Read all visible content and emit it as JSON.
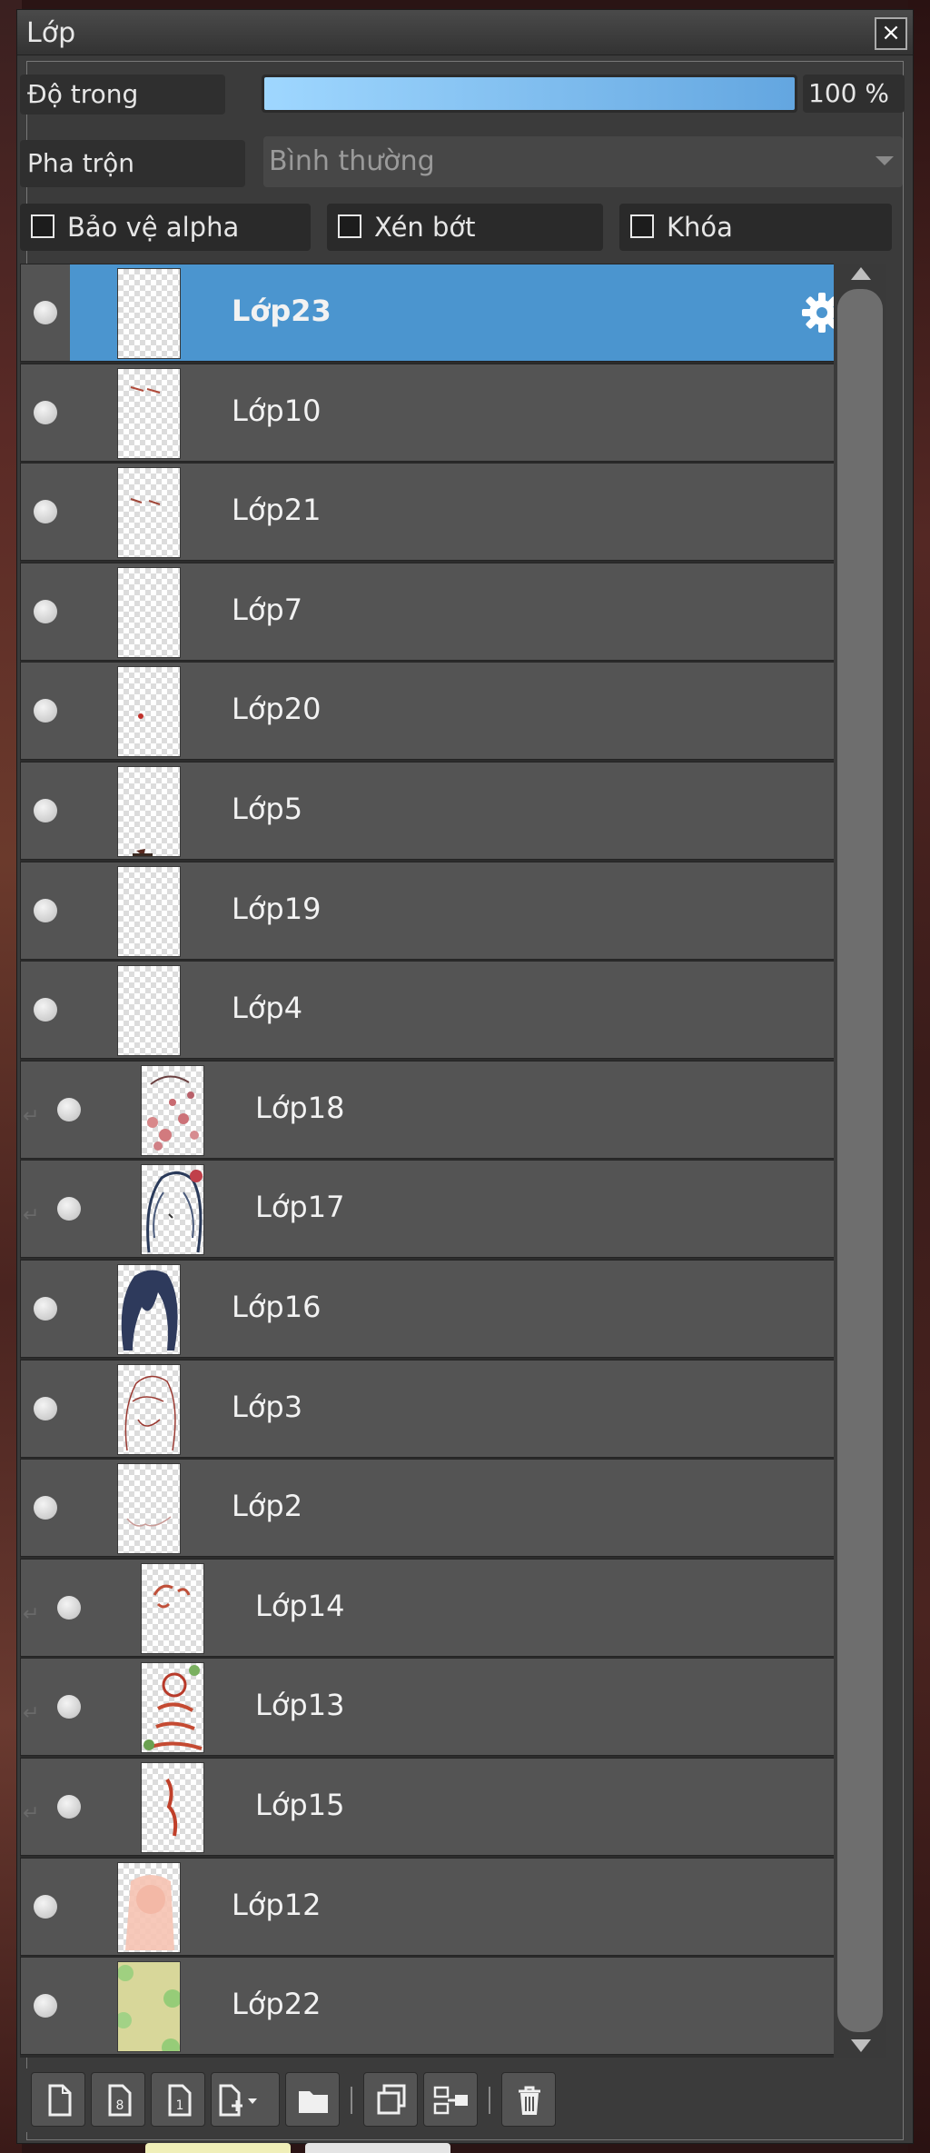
{
  "panel": {
    "title": "Lớp",
    "close_label": "×"
  },
  "opacity": {
    "label": "Độ trong",
    "value_text": "100 %",
    "fraction": 1.0
  },
  "blend": {
    "label": "Pha trộn",
    "selected": "Bình thường"
  },
  "checkboxes": {
    "protect_alpha": "Bảo vệ alpha",
    "clipping": "Xén bớt",
    "lock": "Khóa"
  },
  "layers": [
    {
      "name": "Lớp23",
      "selected": true,
      "clipped": false,
      "thumb": "blank"
    },
    {
      "name": "Lớp10",
      "selected": false,
      "clipped": false,
      "thumb": "strokes-top"
    },
    {
      "name": "Lớp21",
      "selected": false,
      "clipped": false,
      "thumb": "strokes-mid"
    },
    {
      "name": "Lớp7",
      "selected": false,
      "clipped": false,
      "thumb": "blank"
    },
    {
      "name": "Lớp20",
      "selected": false,
      "clipped": false,
      "thumb": "dot-red"
    },
    {
      "name": "Lớp5",
      "selected": false,
      "clipped": false,
      "thumb": "dot-bottom"
    },
    {
      "name": "Lớp19",
      "selected": false,
      "clipped": false,
      "thumb": "blank"
    },
    {
      "name": "Lớp4",
      "selected": false,
      "clipped": false,
      "thumb": "blank"
    },
    {
      "name": "Lớp18",
      "selected": false,
      "clipped": true,
      "thumb": "red-speckle"
    },
    {
      "name": "Lớp17",
      "selected": false,
      "clipped": true,
      "thumb": "hair-outline"
    },
    {
      "name": "Lớp16",
      "selected": false,
      "clipped": false,
      "thumb": "hair-dark"
    },
    {
      "name": "Lớp3",
      "selected": false,
      "clipped": false,
      "thumb": "sketch-red"
    },
    {
      "name": "Lớp2",
      "selected": false,
      "clipped": false,
      "thumb": "sketch-faint"
    },
    {
      "name": "Lớp14",
      "selected": false,
      "clipped": true,
      "thumb": "red-marks"
    },
    {
      "name": "Lớp13",
      "selected": false,
      "clipped": true,
      "thumb": "red-figure"
    },
    {
      "name": "Lớp15",
      "selected": false,
      "clipped": true,
      "thumb": "red-stroke"
    },
    {
      "name": "Lớp12",
      "selected": false,
      "clipped": false,
      "thumb": "skin"
    },
    {
      "name": "Lớp22",
      "selected": false,
      "clipped": false,
      "thumb": "green-bg"
    }
  ],
  "toolbar": [
    {
      "icon": "new-layer-icon"
    },
    {
      "icon": "new-8bit-layer-icon"
    },
    {
      "icon": "new-1bit-layer-icon"
    },
    {
      "icon": "add-layer-dropdown-icon"
    },
    {
      "icon": "folder-icon"
    },
    {
      "icon": "duplicate-layer-icon"
    },
    {
      "icon": "merge-layer-icon"
    },
    {
      "icon": "trash-icon"
    }
  ],
  "colors": {
    "selected_row": "#4b95cf",
    "row": "#545454",
    "opacity_fill_start": "#9fd7ff",
    "opacity_fill_end": "#63a6e0"
  }
}
